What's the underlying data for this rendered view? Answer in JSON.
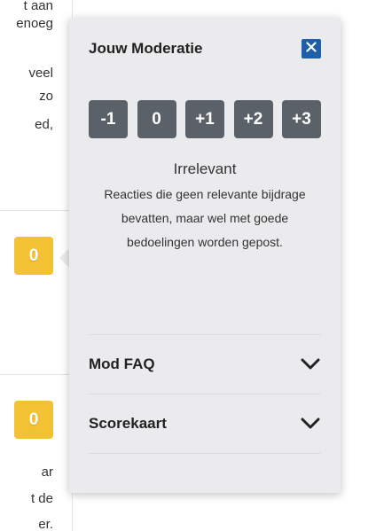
{
  "article": {
    "text_fragments": [
      "t aan",
      "enoeg",
      "veel",
      "zo",
      "ed,",
      "ar",
      "t de",
      "er."
    ]
  },
  "comment_scores": [
    "0",
    "0"
  ],
  "popover": {
    "title": "Jouw Moderatie",
    "close_icon": "close-icon",
    "score_options": [
      "-1",
      "0",
      "+1",
      "+2",
      "+3"
    ],
    "selected_description": {
      "title": "Irrelevant",
      "body": "Reacties die geen relevante bijdrage bevatten, maar wel met goede bedoelingen worden gepost."
    },
    "accordion": [
      {
        "label": "Mod FAQ",
        "icon": "chevron-down-icon"
      },
      {
        "label": "Scorekaart",
        "icon": "chevron-down-icon"
      }
    ]
  },
  "colors": {
    "score_badge": "#f2c233",
    "score_button": "#5a6168",
    "close_button": "#1f5fa8",
    "popover_bg": "#ebebed"
  }
}
